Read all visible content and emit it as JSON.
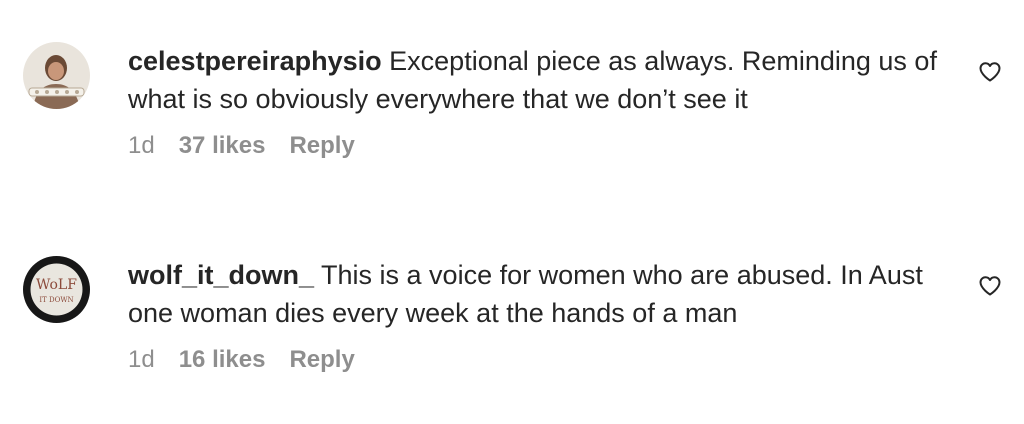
{
  "comments": [
    {
      "username": "celestpereiraphysio",
      "text": "Exceptional piece as always. Reminding us of what is so obviously everywhere that we don’t see it",
      "time": "1d",
      "likes": "37 likes",
      "reply": "Reply",
      "avatar_icon": "person-photo-avatar",
      "like_icon": "heart-outline-icon"
    },
    {
      "username": "wolf_it_down_",
      "text": "This is a voice for women who are abused. In Aust one woman dies every week at the hands of a man",
      "time": "1d",
      "likes": "16 likes",
      "reply": "Reply",
      "avatar_icon": "wolf-it-down-logo-avatar",
      "avatar_logo_text": "WOLF IT DOWN",
      "like_icon": "heart-outline-icon"
    }
  ],
  "colors": {
    "text": "#262626",
    "secondary": "#8e8e8e",
    "background": "#ffffff"
  }
}
